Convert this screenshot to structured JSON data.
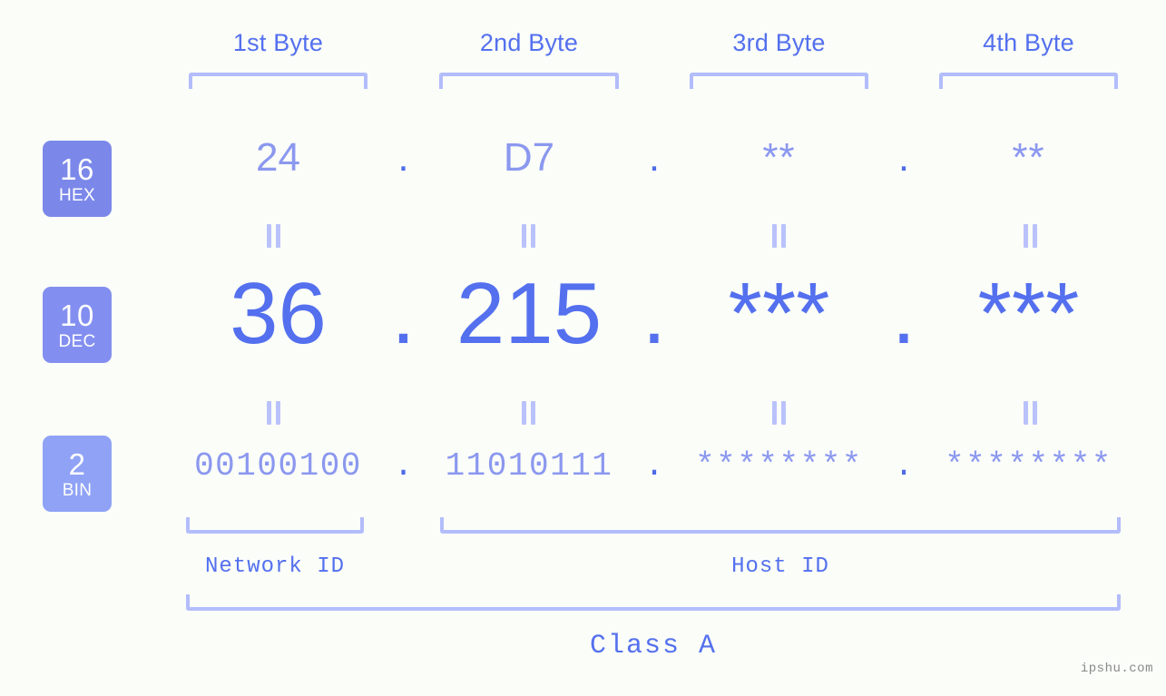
{
  "canvas": {
    "background": "#fbfdf9",
    "accent_strong": "#5470ee",
    "accent_light": "#8b98ef",
    "bracket_color": "#b3bdfb"
  },
  "watermark": "ipshu.com",
  "byte_headers": [
    {
      "label": "1st Byte"
    },
    {
      "label": "2nd Byte"
    },
    {
      "label": "3rd Byte"
    },
    {
      "label": "4th Byte"
    }
  ],
  "radix_rows": [
    {
      "badge_number": "16",
      "badge_name": "HEX",
      "badge_color": "#7b88ea",
      "values": [
        "24",
        "D7",
        "**",
        "**"
      ],
      "separators": [
        ".",
        ".",
        "."
      ]
    },
    {
      "badge_number": "10",
      "badge_name": "DEC",
      "badge_color": "#838ff0",
      "values": [
        "36",
        "215",
        "***",
        "***"
      ],
      "separators": [
        ".",
        ".",
        "."
      ]
    },
    {
      "badge_number": "2",
      "badge_name": "BIN",
      "badge_color": "#8fa2f5",
      "values": [
        "00100100",
        "11010111",
        "********",
        "********"
      ],
      "separators": [
        ".",
        ".",
        "."
      ]
    }
  ],
  "equality_marks": {
    "glyph": "||",
    "rows": [
      "hex-to-dec",
      "dec-to-bin"
    ],
    "count_per_row": 4
  },
  "id_labels": [
    {
      "label": "Network ID"
    },
    {
      "label": "Host ID"
    }
  ],
  "class_label": "Class A"
}
